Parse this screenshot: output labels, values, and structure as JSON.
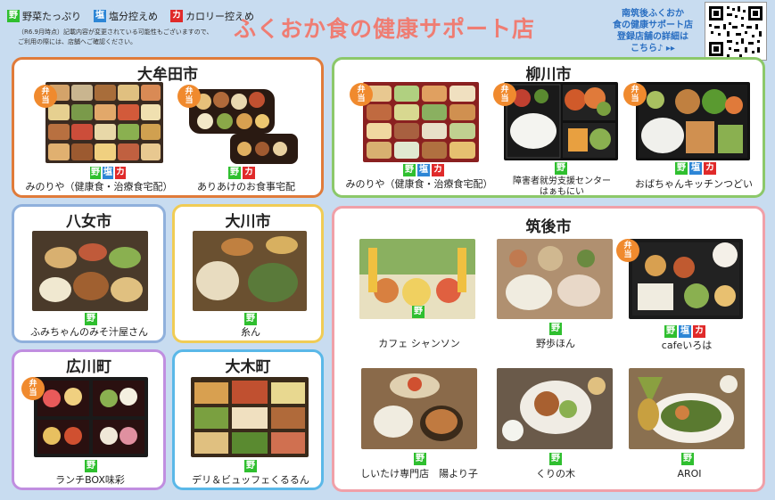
{
  "legend": {
    "veg_tag": "野",
    "veg_label": "野菜たっぷり",
    "salt_tag": "塩",
    "salt_label": "塩分控えめ",
    "cal_tag": "カ",
    "cal_label": "カロリー控えめ",
    "note_line1": "（R6.9月時点）記載内容が変更されている可能性もございますので、",
    "note_line2": "ご利用の際には、店舗へご確認ください。"
  },
  "title": "ふくおか食の健康サポート店",
  "corner_note": {
    "line1": "南筑後ふくおか",
    "line2": "食の健康サポート店",
    "line3": "登録店舗の詳細は",
    "line4": "こちら♪ ▸▸"
  },
  "bento_badge": {
    "top": "弁",
    "bottom": "当"
  },
  "regions": {
    "omuta": {
      "title": "大牟田市"
    },
    "yanagawa": {
      "title": "柳川市"
    },
    "yame": {
      "title": "八女市"
    },
    "okawa": {
      "title": "大川市"
    },
    "chikugo": {
      "title": "筑後市"
    },
    "hirokawa": {
      "title": "広川町"
    },
    "oki": {
      "title": "大木町"
    }
  },
  "shops": {
    "minoriya_omuta": "みのりや（健康食・治療食宅配）",
    "ariake": "ありあけのお食事宅配",
    "minoriya_yanagawa": "みのりや（健康食・治療食宅配）",
    "hanoenie_1": "障害者就労支援センター",
    "hanoenie_2": "はぁもにい",
    "obachan": "おばちゃんキッチンつどい",
    "fumichan": "ふみちゃんのみそ汁屋さん",
    "en": "糸ん",
    "lunchbox": "ランチBOX味彩",
    "deli": "デリ＆ビュッフェくるるん",
    "chanson": "カフェ シャンソン",
    "yahohon": "野歩ほん",
    "iroha": "cafeいろは",
    "shiitake": "しいたけ専門店　陽より子",
    "kurinoki": "くりの木",
    "aroi": "AROI"
  },
  "colors": {
    "background": "#c8dcf0",
    "title": "#ef7d73",
    "veg": "#2fbf2f",
    "salt": "#2d86d6",
    "cal": "#e02a2a",
    "bento": "#f08a2e",
    "omuta_border": "#e07b3a",
    "yanagawa_border": "#8cc86a",
    "yame_border": "#8fb0dc",
    "okawa_border": "#f0cc55",
    "chikugo_border": "#f0a0a8",
    "hirokawa_border": "#c08ee0",
    "oki_border": "#5ab8e8"
  }
}
